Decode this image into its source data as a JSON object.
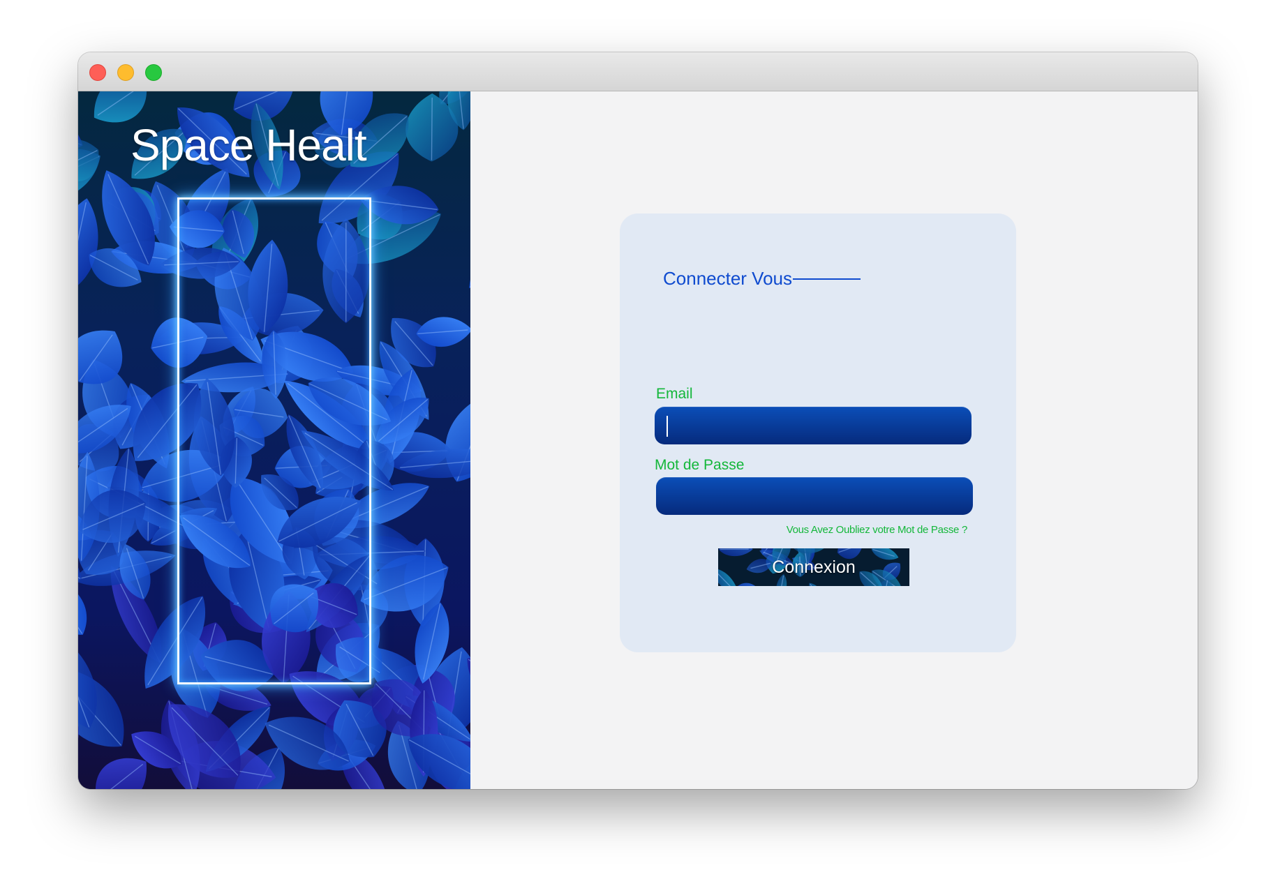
{
  "window": {
    "controls": [
      "close",
      "minimize",
      "maximize"
    ]
  },
  "brand": {
    "title": "Space Healt"
  },
  "login": {
    "heading": "Connecter Vous",
    "email_label": "Email",
    "email_value": "",
    "password_label": "Mot de Passe",
    "password_value": "",
    "forgot_link": "Vous Avez  Oubliez votre Mot de Passe ?",
    "submit_label": "Connexion"
  },
  "colors": {
    "accent_blue": "#0f4bcf",
    "label_green": "#14b73a",
    "field_blue": "#0b4eb8",
    "card_bg": "#e1e9f4"
  }
}
